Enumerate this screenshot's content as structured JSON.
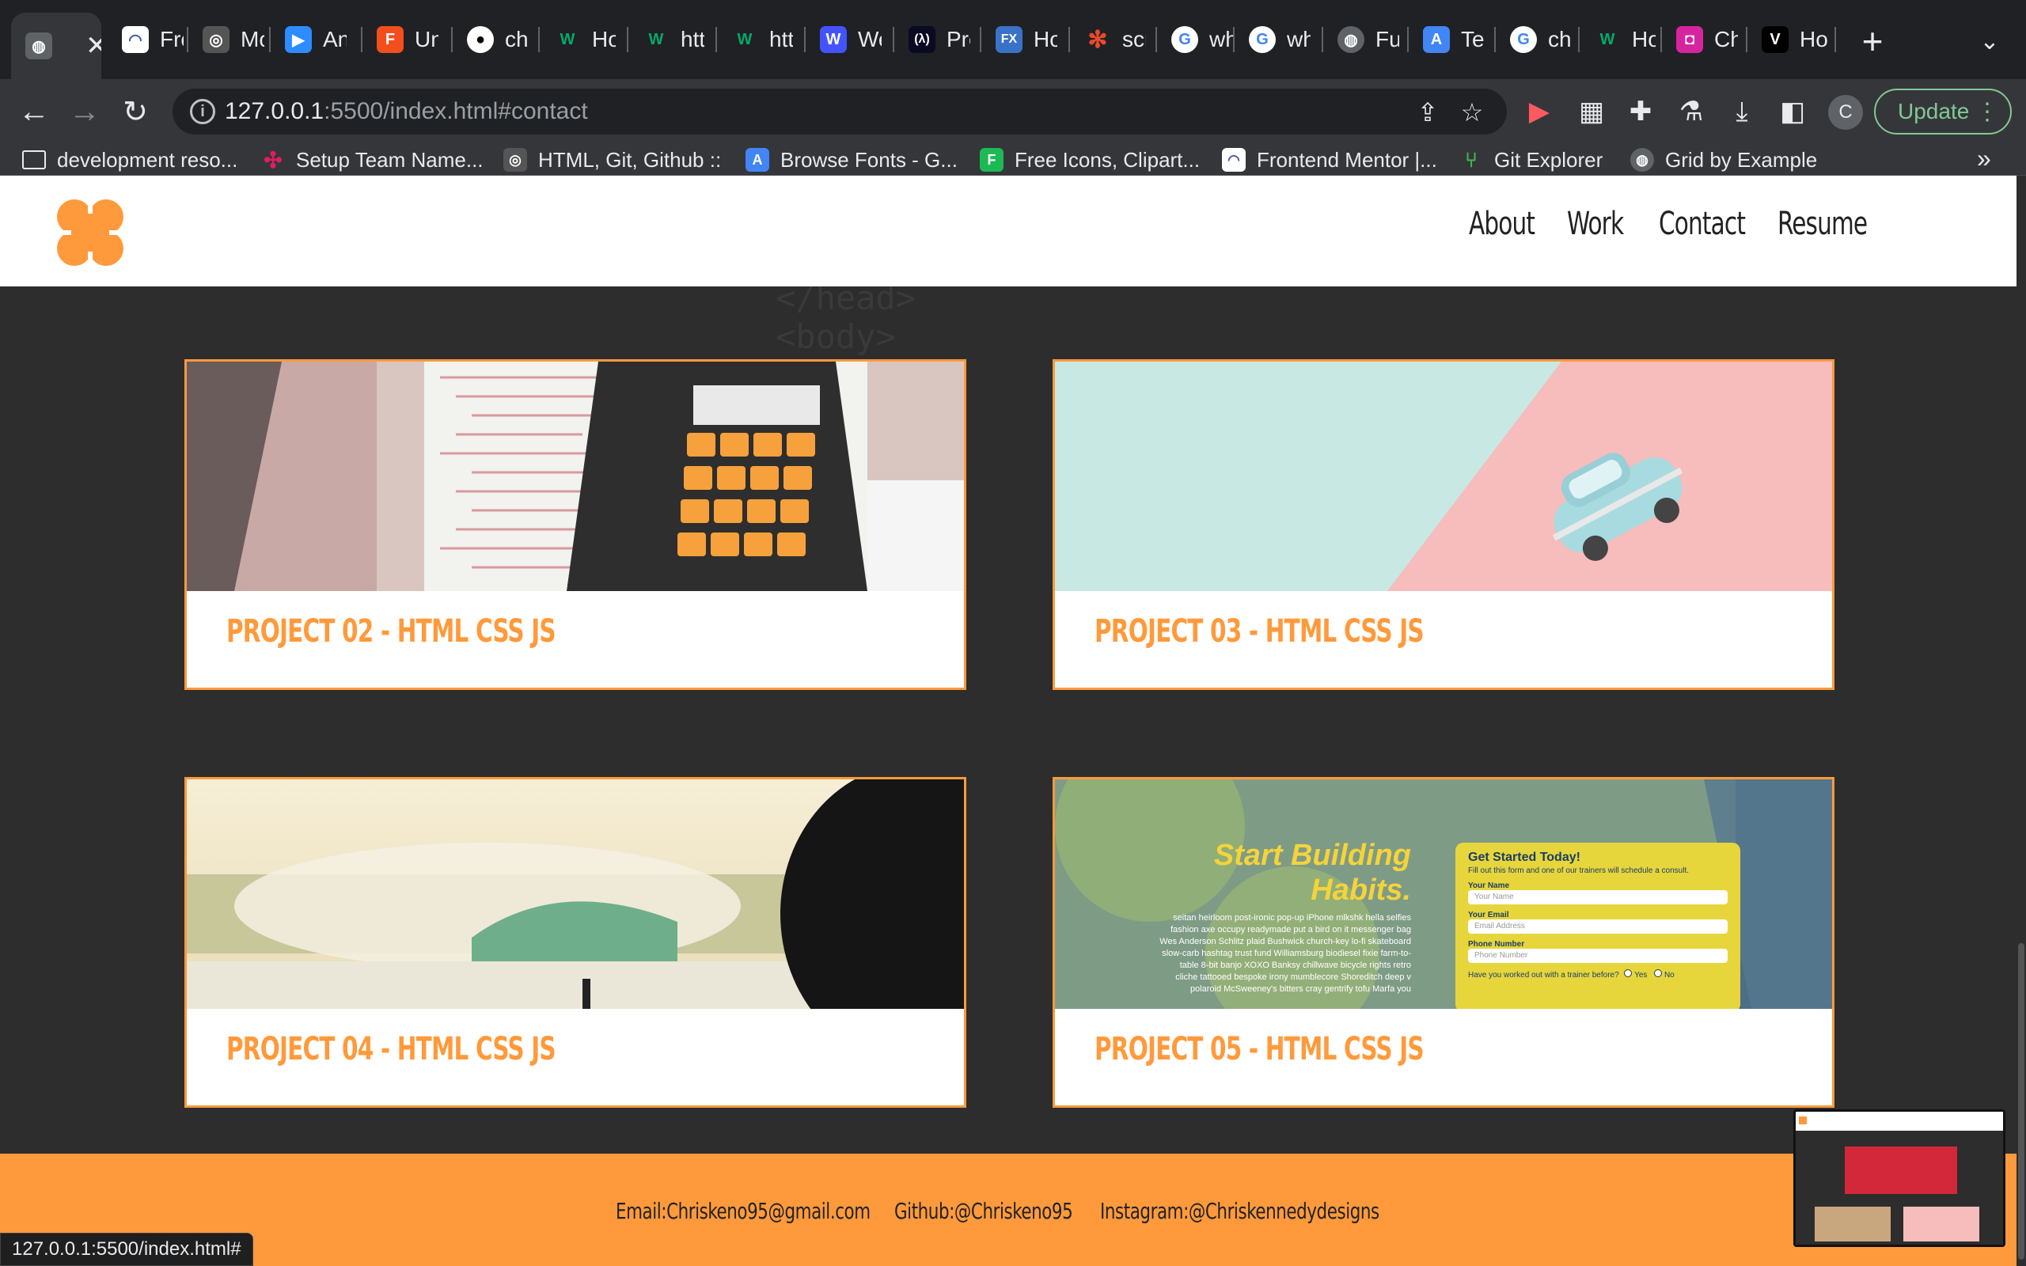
{
  "browser": {
    "tabs": [
      {
        "title": "",
        "favicon": "globe-icon",
        "active": true
      },
      {
        "title": "Fro",
        "favicon": "frontend-mentor-icon"
      },
      {
        "title": "Mc",
        "favicon": "fingerprint-icon"
      },
      {
        "title": "An",
        "favicon": "zoom-icon"
      },
      {
        "title": "Un",
        "favicon": "figma-icon"
      },
      {
        "title": "ch",
        "favicon": "github-icon"
      },
      {
        "title": "Ho",
        "favicon": "w3schools-icon"
      },
      {
        "title": "htt",
        "favicon": "w3schools-icon"
      },
      {
        "title": "htt",
        "favicon": "w3schools-icon"
      },
      {
        "title": "We",
        "favicon": "webflow-icon"
      },
      {
        "title": "Pro",
        "favicon": "freecodecamp-icon"
      },
      {
        "title": "Ho",
        "favicon": "fx-icon"
      },
      {
        "title": "scr",
        "favicon": "asterisk-icon"
      },
      {
        "title": "wh",
        "favicon": "google-icon"
      },
      {
        "title": "wh",
        "favicon": "google-icon"
      },
      {
        "title": "Fu",
        "favicon": "globe-icon"
      },
      {
        "title": "Tel",
        "favicon": "google-fonts-icon"
      },
      {
        "title": "ch",
        "favicon": "google-icon"
      },
      {
        "title": "Ho",
        "favicon": "w3schools-icon"
      },
      {
        "title": "Ch",
        "favicon": "instagram-icon"
      },
      {
        "title": "Ho",
        "favicon": "v-icon"
      }
    ],
    "url_host": "127.0.0.1",
    "url_rest": ":5500/index.html#contact",
    "profile_initial": "C",
    "update_label": "Update",
    "bookmarks": [
      {
        "label": "development reso...",
        "icon": "folder-icon"
      },
      {
        "label": "Setup Team Name...",
        "icon": "slack-icon"
      },
      {
        "label": "HTML, Git, Github ::",
        "icon": "fingerprint-icon"
      },
      {
        "label": "Browse Fonts - G...",
        "icon": "google-fonts-icon"
      },
      {
        "label": "Free Icons, Clipart...",
        "icon": "flaticon-icon"
      },
      {
        "label": "Frontend Mentor |...",
        "icon": "frontend-mentor-icon"
      },
      {
        "label": "Git Explorer",
        "icon": "git-icon"
      },
      {
        "label": "Grid by Example",
        "icon": "globe-icon"
      }
    ],
    "status_url": "127.0.0.1:5500/index.html#"
  },
  "site": {
    "nav": [
      "About",
      "Work",
      "Contact",
      "Resume"
    ],
    "projects": [
      {
        "label": "PROJECT 02 - HTML CSS JS",
        "thumb": "calculator"
      },
      {
        "label": "PROJECT 03 - HTML CSS JS",
        "thumb": "pastel-car"
      },
      {
        "label": "PROJECT 04 - HTML CSS JS",
        "thumb": "surf"
      },
      {
        "label": "PROJECT 05 - HTML CSS JS",
        "thumb": "fitness-form"
      }
    ],
    "project05_thumb": {
      "headline_1": "Start Building",
      "headline_2": "Habits.",
      "body": "seitan heirloom post-ironic pop-up iPhone mlkshk hella selfies fashion axe occupy readymade put a bird on it messenger bag Wes Anderson Schlitz plaid Bushwick church-key lo-fi skateboard slow-carb hashtag trust fund Williamsburg biodiesel fixie farm-to-table 8-bit banjo XOXO Banksy chillwave bicycle rights retro cliche tattooed bespoke irony mumblecore Shoreditch deep v polaroid McSweeney's bitters cray gentrify tofu Marfa you",
      "form_title": "Get Started Today!",
      "form_sub": "Fill out this form and one of our trainers will schedule a consult.",
      "name_label": "Your Name",
      "name_placeholder": "Your Name",
      "email_label": "Your Email",
      "email_placeholder": "Email Address",
      "phone_label": "Phone Number",
      "phone_placeholder": "Phone Number",
      "trainer_question": "Have you worked out with a trainer before?",
      "yes": "Yes",
      "no": "No"
    },
    "footer": {
      "email": "Email:Chriskeno95@gmail.com",
      "github": "Github:@Chriskeno95",
      "instagram": "Instagram:@Chriskennedydesigns"
    }
  }
}
